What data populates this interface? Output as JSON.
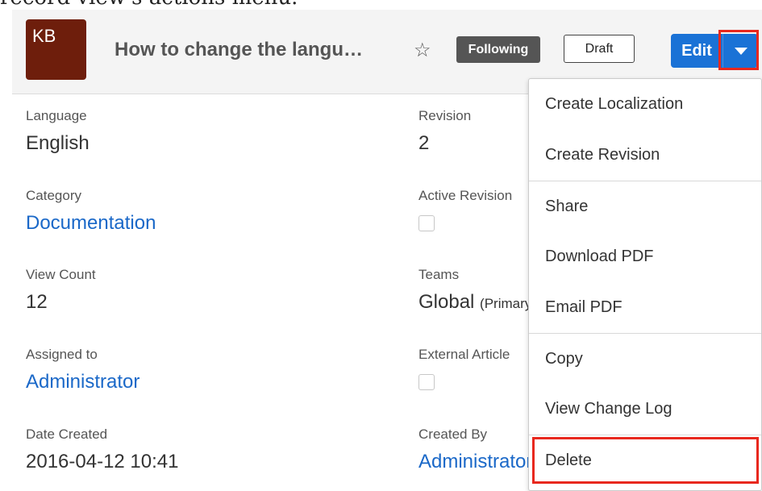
{
  "caption": "record view's actions menu.",
  "header": {
    "avatar_text": "KB",
    "title": "How to change the langu…",
    "following_label": "Following",
    "status_label": "Draft",
    "edit_label": "Edit"
  },
  "fields": {
    "language": {
      "label": "Language",
      "value": "English"
    },
    "category": {
      "label": "Category",
      "value": "Documentation"
    },
    "view_count": {
      "label": "View Count",
      "value": "12"
    },
    "assigned_to": {
      "label": "Assigned to",
      "value": "Administrator"
    },
    "date_created": {
      "label": "Date Created",
      "value": "2016-04-12 10:41"
    },
    "revision": {
      "label": "Revision",
      "value": "2"
    },
    "active_revision": {
      "label": "Active Revision"
    },
    "teams": {
      "label": "Teams",
      "value": "Global",
      "suffix": "(Primary)"
    },
    "external_article": {
      "label": "External Article"
    },
    "created_by": {
      "label": "Created By",
      "value": "Administrator"
    }
  },
  "menu": {
    "items": [
      {
        "label": "Create Localization"
      },
      {
        "label": "Create Revision"
      },
      {
        "label": "Share"
      },
      {
        "label": "Download PDF"
      },
      {
        "label": "Email PDF"
      },
      {
        "label": "Copy"
      },
      {
        "label": "View Change Log"
      },
      {
        "label": "Delete"
      }
    ]
  },
  "colors": {
    "primary": "#1a72d6",
    "highlight": "#e8281e",
    "avatar": "#6e1e0c",
    "link": "#1a68c8"
  }
}
